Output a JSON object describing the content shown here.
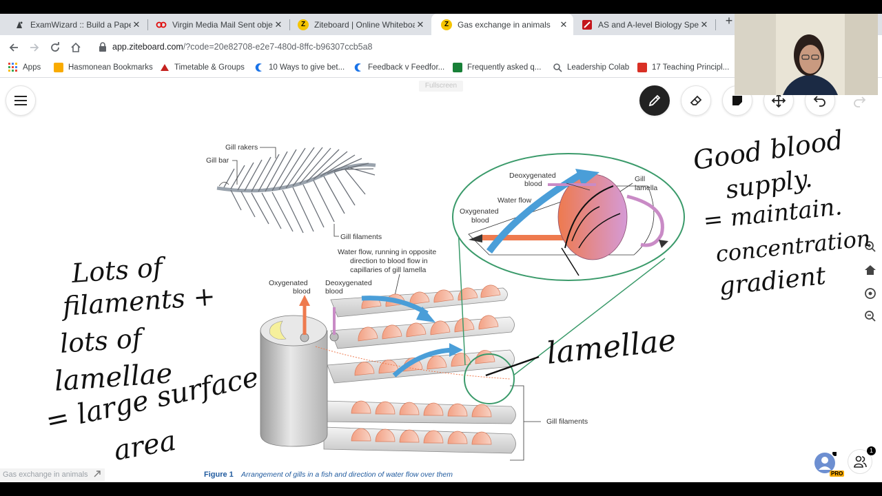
{
  "browser": {
    "tabs": [
      {
        "title": "ExamWizard :: Build a Paper",
        "active": false
      },
      {
        "title": "Virgin Media Mail Sent objec",
        "active": false
      },
      {
        "title": "Ziteboard | Online Whiteboa",
        "active": false
      },
      {
        "title": "Gas exchange in animals",
        "active": true
      },
      {
        "title": "AS and A-level Biology Spec",
        "active": false
      }
    ],
    "tab_close": "✕",
    "url_host": "app.ziteboard.com",
    "url_rest": "/?code=20e82708-e2e7-480d-8ffc-b96307ccb5a8",
    "bookmarks": [
      {
        "label": "Apps",
        "color": "#ea4335"
      },
      {
        "label": "Hasmonean Bookmarks",
        "color": "#f9ab00"
      },
      {
        "label": "Timetable & Groups",
        "color": "#c5221f"
      },
      {
        "label": "10 Ways to give bet...",
        "color": "#1a73e8"
      },
      {
        "label": "Feedback v Feedfor...",
        "color": "#1a73e8"
      },
      {
        "label": "Frequently asked q...",
        "color": "#188038"
      },
      {
        "label": "Leadership Colab",
        "color": "#5f6368"
      },
      {
        "label": "17 Teaching Principl...",
        "color": "#d93025"
      }
    ]
  },
  "board": {
    "fullscreen_label": "Fullscreen",
    "board_name": "Gas exchange in animals",
    "collaborators": "1",
    "pro_badge": "PRO"
  },
  "diagram": {
    "gill_rakers": "Gill rakers",
    "gill_bar": "Gill bar",
    "gill_filaments_top": "Gill filaments",
    "water_flow_note_1": "Water flow, running in opposite",
    "water_flow_note_2": "direction to blood flow in",
    "water_flow_note_3": "capillaries of gill lamella",
    "oxygenated_1": "Oxygenated",
    "oxygenated_2": "blood",
    "deoxygenated_1": "Deoxygenated",
    "deoxygenated_2": "blood",
    "inset_deoxygenated_1": "Deoxygenated",
    "inset_deoxygenated_2": "blood",
    "inset_gill_1": "Gill",
    "inset_gill_2": "lamella",
    "inset_water_flow": "Water flow",
    "inset_oxygenated_1": "Oxygenated",
    "inset_oxygenated_2": "blood",
    "gill_filaments_bottom": "Gill filaments",
    "figure_label": "Figure 1",
    "figure_caption": "Arrangement of gills in a fish and direction of water flow over them"
  },
  "handwriting": {
    "left_1": "Lots of",
    "left_2": "filaments +",
    "left_3": "lots of",
    "left_4": "lamellae",
    "left_5": "= large surface",
    "left_6": "area",
    "right_1": "Good blood",
    "right_2": "supply.",
    "right_3": "= maintain.",
    "right_4": "concentration",
    "right_5": "gradient",
    "lamellae": "lamellae"
  },
  "colors": {
    "accent_green": "#3a9a6a",
    "oxygenated": "#ee7a4e",
    "deoxygenated": "#c98bc6",
    "water": "#4a9ed8"
  }
}
